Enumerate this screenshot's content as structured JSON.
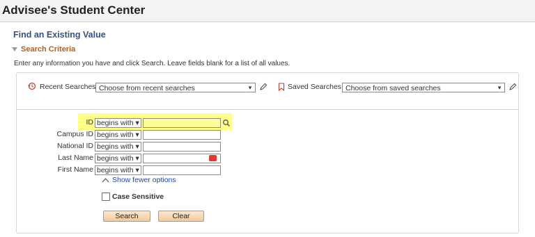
{
  "header": {
    "title": "Advisee's Student Center"
  },
  "find": {
    "title": "Find an Existing Value",
    "criteria_label": "Search Criteria",
    "instructions": "Enter any information you have and click Search. Leave fields blank for a list of all values."
  },
  "recent": {
    "label": "Recent Searches",
    "placeholder": "Choose from recent searches"
  },
  "saved": {
    "label": "Saved Searches",
    "placeholder": "Choose from saved searches"
  },
  "fields": [
    {
      "label": "ID",
      "operator": "begins with",
      "value": ""
    },
    {
      "label": "Campus ID",
      "operator": "begins with",
      "value": ""
    },
    {
      "label": "National ID",
      "operator": "begins with",
      "value": ""
    },
    {
      "label": "Last Name",
      "operator": "begins with",
      "value": ""
    },
    {
      "label": "First Name",
      "operator": "begins with",
      "value": ""
    }
  ],
  "options": {
    "fewer_label": "Show fewer options",
    "case_label": "Case Sensitive",
    "case_checked": false
  },
  "buttons": {
    "search": "Search",
    "clear": "Clear"
  },
  "colors": {
    "accent_title": "#31528a",
    "criteria": "#b0611f",
    "highlight": "#ffff88",
    "link": "#1e43b8"
  }
}
